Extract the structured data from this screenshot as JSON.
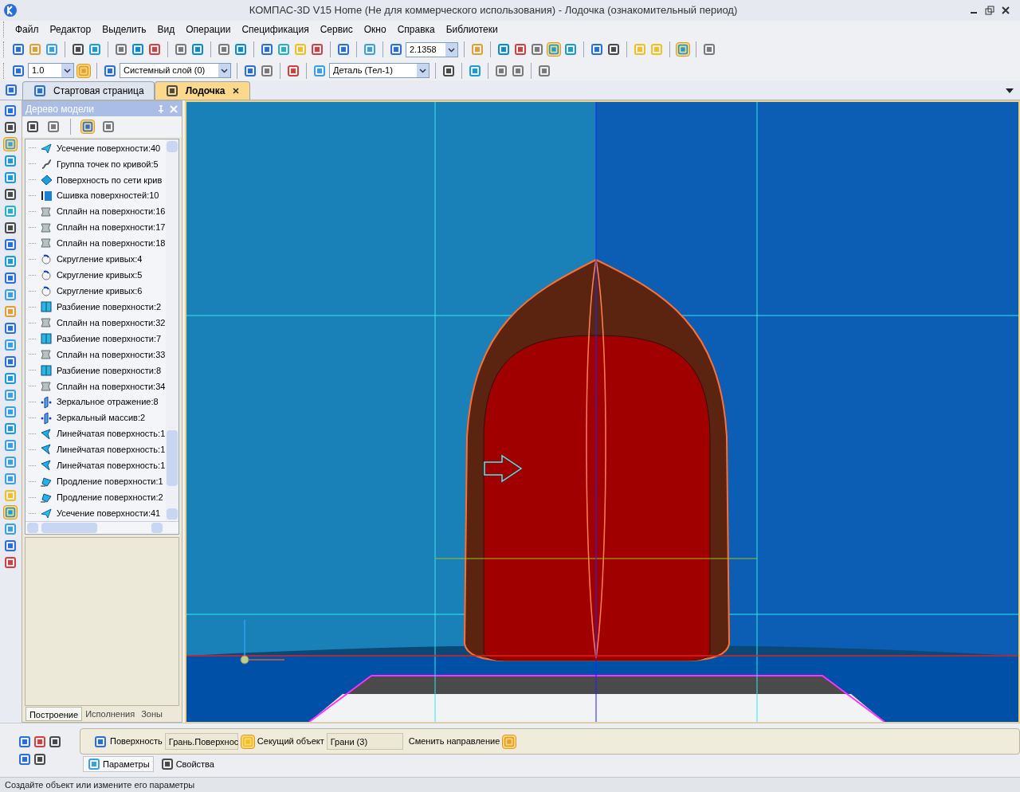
{
  "window": {
    "title": "КОМПАС-3D V15 Home (Не для коммерческого использования) - Лодочка (ознакомительный период)"
  },
  "menu": [
    {
      "label": "Файл"
    },
    {
      "label": "Редактор"
    },
    {
      "label": "Выделить"
    },
    {
      "label": "Вид"
    },
    {
      "label": "Операции"
    },
    {
      "label": "Спецификация"
    },
    {
      "label": "Сервис"
    },
    {
      "label": "Окно"
    },
    {
      "label": "Справка"
    },
    {
      "label": "Библиотеки"
    }
  ],
  "toolbar": {
    "zoom": "2.1358",
    "scale": "1.0",
    "layer": "Системный слой (0)",
    "part": "Деталь (Тел-1)"
  },
  "tabs": [
    {
      "label": "Стартовая страница",
      "selected": false
    },
    {
      "label": "Лодочка",
      "selected": true
    }
  ],
  "model_tree": {
    "title": "Дерево модели",
    "items": [
      {
        "label": "Усечение поверхности:40",
        "kind": "trim"
      },
      {
        "label": "Группа точек по кривой:5",
        "kind": "points"
      },
      {
        "label": "Поверхность по сети крив",
        "kind": "network"
      },
      {
        "label": "Сшивка поверхностей:10",
        "kind": "sew"
      },
      {
        "label": "Сплайн на поверхности:16",
        "kind": "spline"
      },
      {
        "label": "Сплайн на поверхности:17",
        "kind": "spline"
      },
      {
        "label": "Сплайн на поверхности:18",
        "kind": "spline"
      },
      {
        "label": "Скругление кривых:4",
        "kind": "fillet"
      },
      {
        "label": "Скругление кривых:5",
        "kind": "fillet"
      },
      {
        "label": "Скругление кривых:6",
        "kind": "fillet"
      },
      {
        "label": "Разбиение поверхности:2",
        "kind": "split"
      },
      {
        "label": "Сплайн на поверхности:32",
        "kind": "spline"
      },
      {
        "label": "Разбиение поверхности:7",
        "kind": "split"
      },
      {
        "label": "Сплайн на поверхности:33",
        "kind": "spline"
      },
      {
        "label": "Разбиение поверхности:8",
        "kind": "split"
      },
      {
        "label": "Сплайн на поверхности:34",
        "kind": "spline"
      },
      {
        "label": "Зеркальное отражение:8",
        "kind": "mirror"
      },
      {
        "label": "Зеркальный массив:2",
        "kind": "mirror"
      },
      {
        "label": "Линейчатая поверхность:1",
        "kind": "ruled"
      },
      {
        "label": "Линейчатая поверхность:1",
        "kind": "ruled"
      },
      {
        "label": "Линейчатая поверхность:1",
        "kind": "ruled"
      },
      {
        "label": "Продление поверхности:1",
        "kind": "extend"
      },
      {
        "label": "Продление поверхности:2",
        "kind": "extend"
      },
      {
        "label": "Усечение поверхности:41",
        "kind": "trim"
      }
    ],
    "tabs": [
      {
        "label": "Построение",
        "selected": true
      },
      {
        "label": "Исполнения",
        "selected": false
      },
      {
        "label": "Зоны",
        "selected": false
      }
    ]
  },
  "properties": {
    "fields": [
      {
        "label": "Поверхность",
        "value": "Грань.Поверхнос"
      },
      {
        "label": "Секущий объект",
        "value": "Грани (3)"
      }
    ],
    "action": "Сменить направление",
    "tabs": [
      {
        "label": "Параметры",
        "selected": true
      },
      {
        "label": "Свойства",
        "selected": false
      }
    ]
  },
  "status_bar": "Создайте объект или измените его параметры"
}
